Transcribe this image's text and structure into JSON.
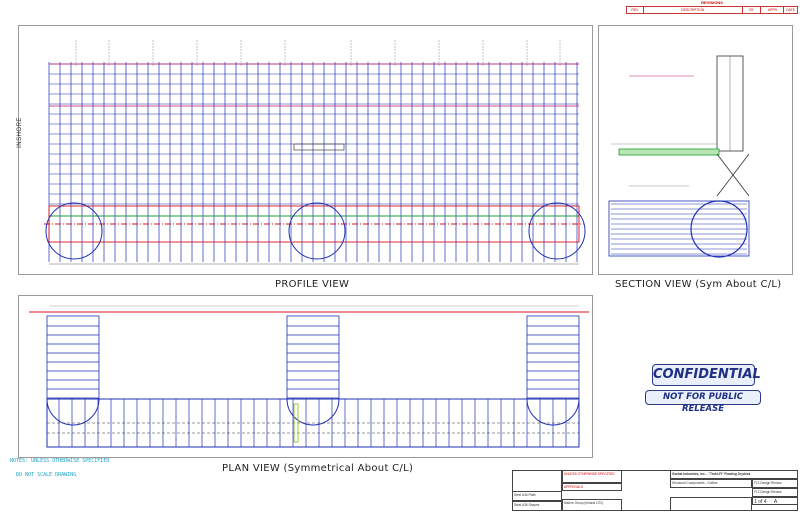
{
  "revisions": {
    "title": "REVISIONS",
    "columns": [
      "REV",
      "DESCRIPTION",
      "BY",
      "APPR",
      "DATE"
    ]
  },
  "views": {
    "profile": {
      "title": "PROFILE VIEW",
      "side_label": "INSHORE"
    },
    "section": {
      "title": "SECTION VIEW (Sym About C/L)"
    },
    "plan": {
      "title": "PLAN VIEW (Symmetrical About C/L)"
    }
  },
  "stamps": {
    "confidential": "CONFIDENTIAL",
    "not_public": "NOT FOR PUBLIC RELEASE"
  },
  "notes": {
    "line1": "NOTES: UNLESS OTHERWISE SPECIFIED",
    "line2": "DO NOT SCALE DRAWING"
  },
  "title_block": {
    "company": "Gorbal Industries, Inc. - \"TechLFI\" Floating Drydock",
    "review_a": "FLT-Design Review",
    "drawing_title": "Structural Components - Outline",
    "review_b": "FLT-Design Review",
    "sheet_num": "1",
    "sheet_of": "of",
    "sheet_total": "4",
    "revision": "A",
    "unless_spec": "UNLESS OTHERWISE SPECIFIED",
    "approvals": "APPROVALS",
    "material_a": "Steel A36 Plate",
    "material_b": "Steel A36 Shapes",
    "drawn_by": "Marine Group (Ireland LTD)"
  },
  "colors": {
    "profile_lines": "#1f2fb5",
    "center_line": "#d6161d",
    "accent_green": "#1d9b3a",
    "stamp_blue": "#2c3a86"
  }
}
